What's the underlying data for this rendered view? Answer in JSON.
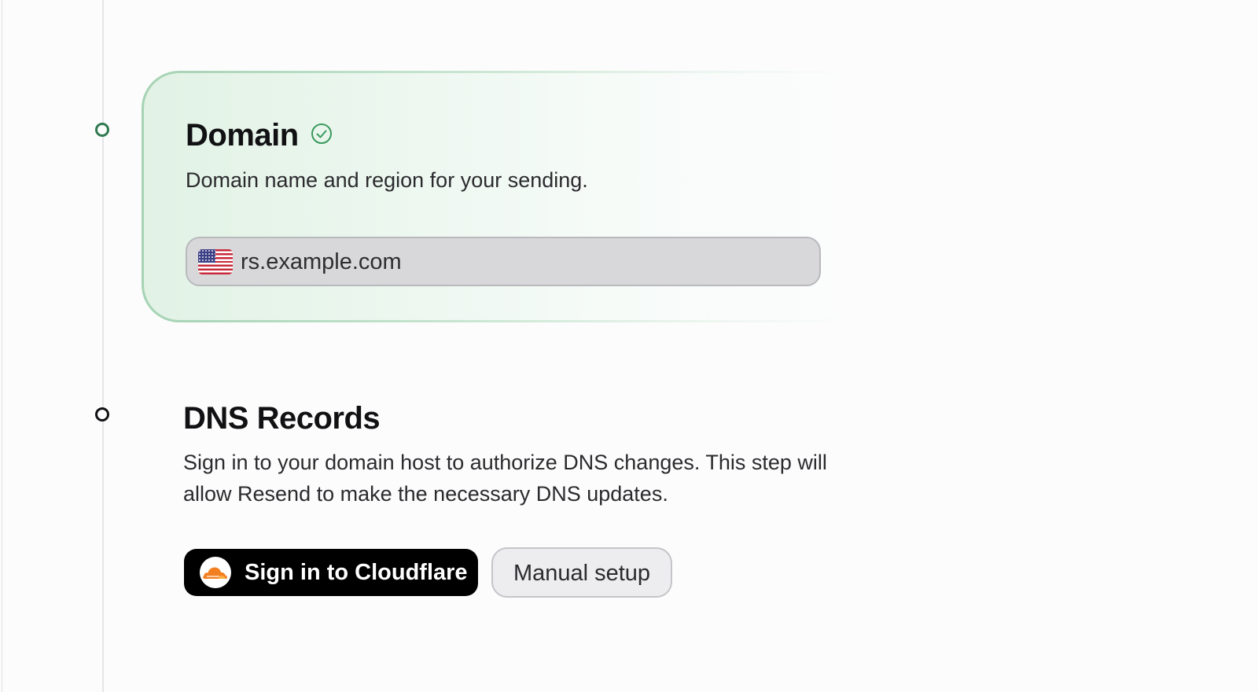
{
  "steps": [
    {
      "title": "Domain",
      "status": "completed",
      "status_icon": "check-circle-icon",
      "description": "Domain name and region for your sending.",
      "field": {
        "region_flag": "us-flag-icon",
        "value": "rs.example.com"
      }
    },
    {
      "title": "DNS Records",
      "description": "Sign in to your domain host to authorize DNS changes. This step will allow Resend to make the necessary DNS updates.",
      "buttons": {
        "cloudflare": {
          "label": "Sign in to Cloudflare",
          "icon": "cloudflare-icon"
        },
        "manual": {
          "label": "Manual setup"
        }
      }
    }
  ],
  "colors": {
    "completed_accent": "#2f7a50",
    "card_background": "#e2f2e5",
    "primary_button": "#000000",
    "cloudflare_orange": "#f38020"
  }
}
